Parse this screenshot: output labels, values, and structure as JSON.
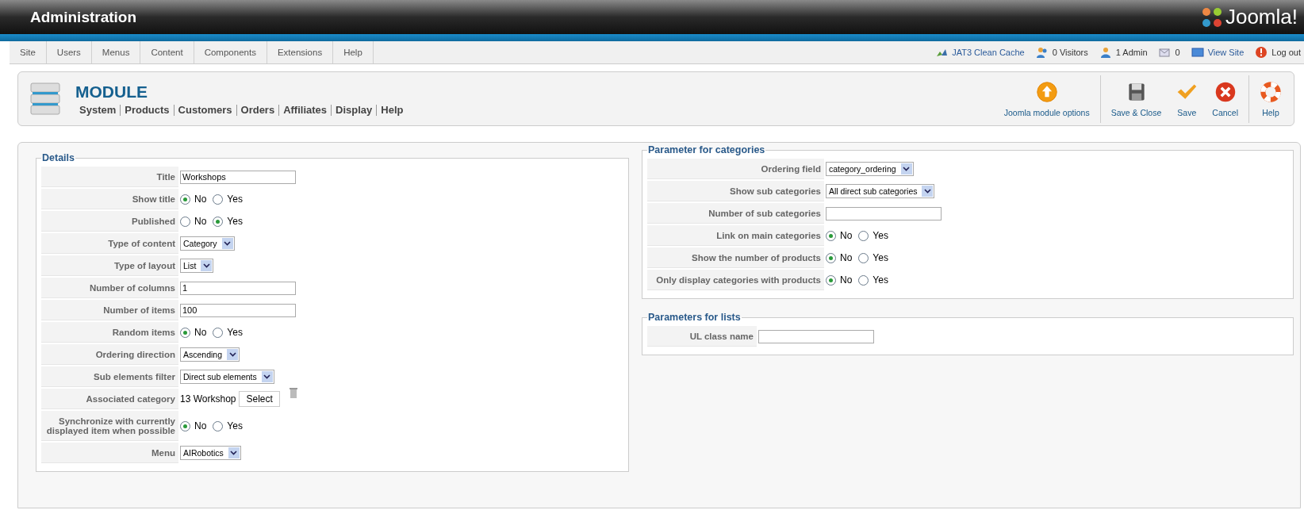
{
  "header": {
    "title": "Administration",
    "logo": "Joomla!"
  },
  "menu": [
    {
      "label": "Site"
    },
    {
      "label": "Users"
    },
    {
      "label": "Menus"
    },
    {
      "label": "Content"
    },
    {
      "label": "Components"
    },
    {
      "label": "Extensions"
    },
    {
      "label": "Help"
    }
  ],
  "status": [
    {
      "kind": "cache",
      "label": "JAT3 Clean Cache"
    },
    {
      "kind": "visitors",
      "label": "0 Visitors"
    },
    {
      "kind": "admin",
      "label": "1 Admin"
    },
    {
      "kind": "mail",
      "label": "0"
    },
    {
      "kind": "site",
      "label": "View Site"
    },
    {
      "kind": "logout",
      "label": "Log out"
    }
  ],
  "module": {
    "title": "MODULE",
    "tabs": [
      {
        "label": "System"
      },
      {
        "label": "Products"
      },
      {
        "label": "Customers"
      },
      {
        "label": "Orders"
      },
      {
        "label": "Affiliates"
      },
      {
        "label": "Display"
      },
      {
        "label": "Help"
      }
    ]
  },
  "toolbar": [
    {
      "kind": "options",
      "label": "Joomla module options"
    },
    {
      "kind": "save-close",
      "label": "Save & Close"
    },
    {
      "kind": "save",
      "label": "Save"
    },
    {
      "kind": "cancel",
      "label": "Cancel"
    },
    {
      "kind": "help",
      "label": "Help"
    }
  ],
  "details": {
    "legend": "Details",
    "rows": [
      {
        "kind": "text",
        "label": "Title",
        "value": "Workshops"
      },
      {
        "kind": "radio",
        "label": "Show title",
        "options": [
          {
            "label": "No",
            "selected": true
          },
          {
            "label": "Yes",
            "selected": false
          }
        ]
      },
      {
        "kind": "radio",
        "label": "Published",
        "options": [
          {
            "label": "No",
            "selected": false
          },
          {
            "label": "Yes",
            "selected": true
          }
        ]
      },
      {
        "kind": "select",
        "label": "Type of content",
        "value": "Category"
      },
      {
        "kind": "select",
        "label": "Type of layout",
        "value": "List"
      },
      {
        "kind": "text",
        "label": "Number of columns",
        "value": "1"
      },
      {
        "kind": "text",
        "label": "Number of items",
        "value": "100"
      },
      {
        "kind": "radio",
        "label": "Random items",
        "options": [
          {
            "label": "No",
            "selected": true
          },
          {
            "label": "Yes",
            "selected": false
          }
        ]
      },
      {
        "kind": "select",
        "label": "Ordering direction",
        "value": "Ascending"
      },
      {
        "kind": "select",
        "label": "Sub elements filter",
        "value": "Direct sub elements"
      },
      {
        "kind": "category",
        "label": "Associated category",
        "value": "13 Workshop",
        "button": "Select"
      },
      {
        "kind": "radio",
        "label": "Synchronize with currently displayed item when possible",
        "options": [
          {
            "label": "No",
            "selected": true
          },
          {
            "label": "Yes",
            "selected": false
          }
        ]
      },
      {
        "kind": "select",
        "label": "Menu",
        "value": "AIRobotics"
      }
    ]
  },
  "categories": {
    "legend": "Parameter for categories",
    "rows": [
      {
        "kind": "select",
        "label": "Ordering field",
        "value": "category_ordering"
      },
      {
        "kind": "select",
        "label": "Show sub categories",
        "value": "All direct sub categories"
      },
      {
        "kind": "text",
        "label": "Number of sub categories"
      },
      {
        "kind": "radio",
        "label": "Link on main categories",
        "options": [
          {
            "label": "No",
            "selected": true
          },
          {
            "label": "Yes",
            "selected": false
          }
        ]
      },
      {
        "kind": "radio",
        "label": "Show the number of products",
        "options": [
          {
            "label": "No",
            "selected": true
          },
          {
            "label": "Yes",
            "selected": false
          }
        ]
      },
      {
        "kind": "radio",
        "label": "Only display categories with products",
        "options": [
          {
            "label": "No",
            "selected": true
          },
          {
            "label": "Yes",
            "selected": false
          }
        ]
      }
    ]
  },
  "lists": {
    "legend": "Parameters for lists",
    "rows": [
      {
        "kind": "text",
        "label": "UL class name"
      }
    ]
  }
}
